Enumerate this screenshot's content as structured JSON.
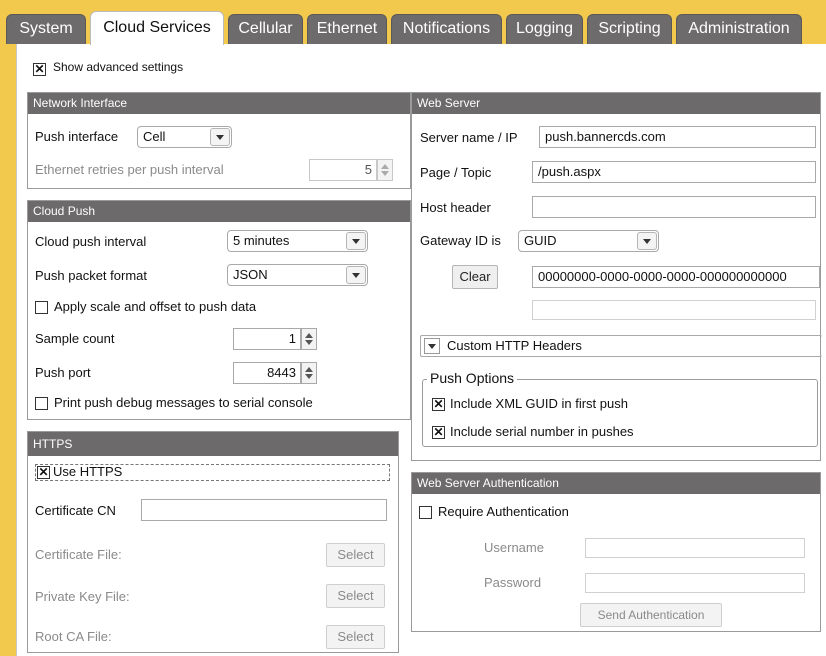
{
  "tabs": [
    {
      "label": "System"
    },
    {
      "label": "Cloud Services"
    },
    {
      "label": "Cellular"
    },
    {
      "label": "Ethernet"
    },
    {
      "label": "Notifications"
    },
    {
      "label": "Logging"
    },
    {
      "label": "Scripting"
    },
    {
      "label": "Administration"
    }
  ],
  "active_tab": "Cloud Services",
  "advanced": {
    "label": "Show advanced settings",
    "checked": "✕"
  },
  "network_interface": {
    "title": "Network Interface",
    "push_interface_label": "Push interface",
    "push_interface_value": "Cell",
    "ethernet_retries_label": "Ethernet retries per push interval",
    "ethernet_retries_value": "5"
  },
  "cloud_push": {
    "title": "Cloud Push",
    "interval_label": "Cloud push interval",
    "interval_value": "5 minutes",
    "format_label": "Push packet format",
    "format_value": "JSON",
    "scale_label": "Apply scale and offset to push data",
    "sample_count_label": "Sample count",
    "sample_count_value": "1",
    "push_port_label": "Push port",
    "push_port_value": "8443",
    "debug_label": "Print push debug messages to serial console"
  },
  "https": {
    "title": "HTTPS",
    "use_https_label": "Use HTTPS",
    "use_https_checked": "✕",
    "cert_cn_label": "Certificate CN",
    "cert_cn_value": "",
    "cert_file_label": "Certificate File:",
    "private_key_label": "Private Key File:",
    "root_ca_label": "Root CA File:",
    "select_label": "Select"
  },
  "web_server": {
    "title": "Web Server",
    "server_label": "Server name / IP",
    "server_value": "push.bannercds.com",
    "page_label": "Page / Topic",
    "page_value": "/push.aspx",
    "host_label": "Host header",
    "host_value": "",
    "gateway_label": "Gateway ID is",
    "gateway_value": "GUID",
    "clear_label": "Clear",
    "guid_value": "00000000-0000-0000-0000-000000000000",
    "custom_headers_label": "Custom HTTP Headers",
    "push_options_legend": "Push Options",
    "xml_guid_label": "Include XML GUID in first push",
    "xml_guid_checked": "✕",
    "serial_label": "Include serial number in pushes",
    "serial_checked": "✕"
  },
  "auth": {
    "title": "Web Server Authentication",
    "require_label": "Require Authentication",
    "username_label": "Username",
    "password_label": "Password",
    "send_label": "Send Authentication"
  },
  "colors": {
    "background": "#f2c94c",
    "tab": "#6d6b6b",
    "panel_header": "#6c6a6a"
  }
}
